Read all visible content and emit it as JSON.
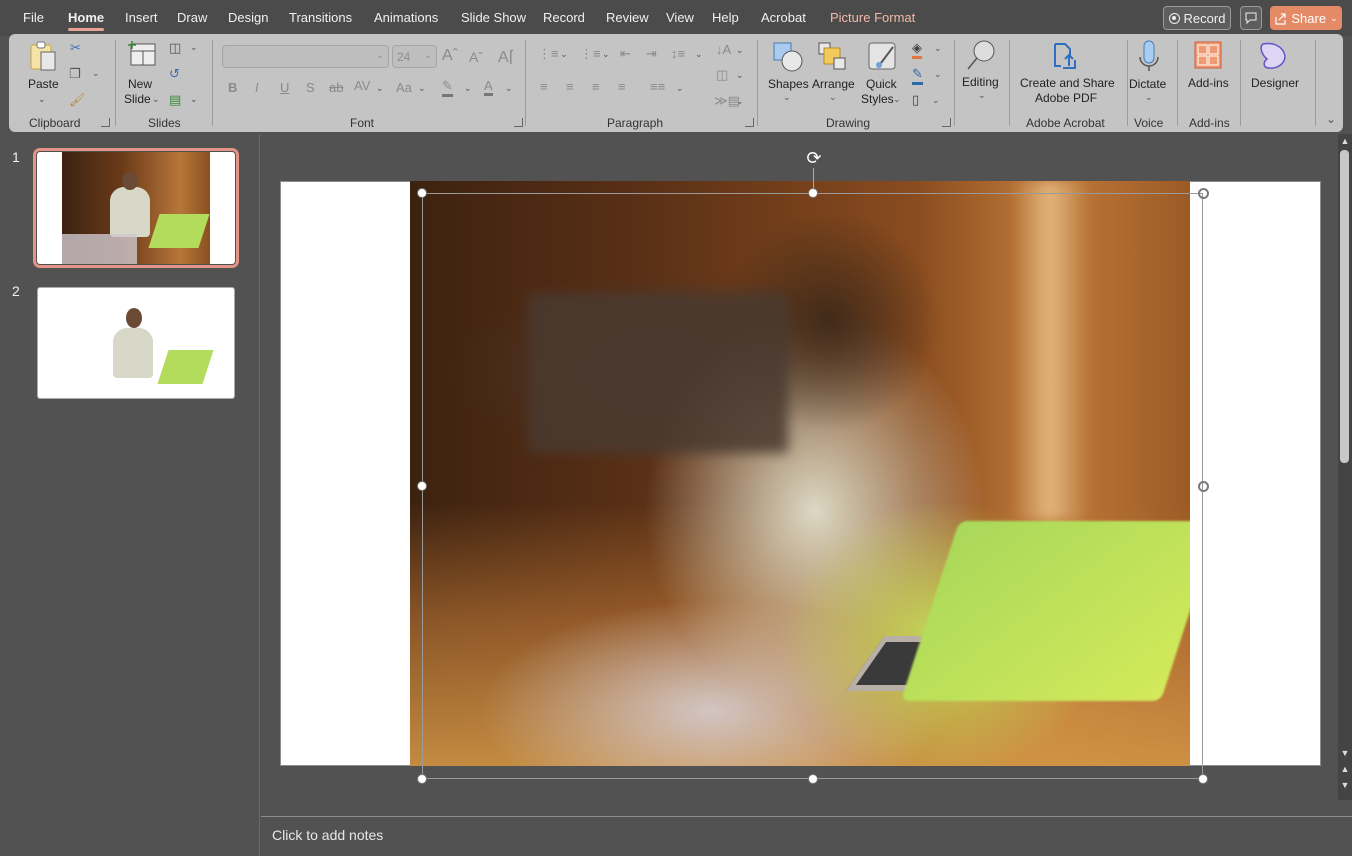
{
  "menubar": {
    "tabs": [
      {
        "label": "File"
      },
      {
        "label": "Home",
        "active": true
      },
      {
        "label": "Insert"
      },
      {
        "label": "Draw"
      },
      {
        "label": "Design"
      },
      {
        "label": "Transitions"
      },
      {
        "label": "Animations"
      },
      {
        "label": "Slide Show"
      },
      {
        "label": "Record"
      },
      {
        "label": "Review"
      },
      {
        "label": "View"
      },
      {
        "label": "Help"
      },
      {
        "label": "Acrobat"
      },
      {
        "label": "Picture Format",
        "contextual": true
      }
    ],
    "record_button": "Record",
    "comment_icon": "comment-icon",
    "share_button": "Share"
  },
  "ribbon": {
    "clipboard": {
      "paste": "Paste",
      "group": "Clipboard"
    },
    "slides": {
      "new_slide_line1": "New",
      "new_slide_line2": "Slide",
      "group": "Slides"
    },
    "font": {
      "font_name": "",
      "font_size": "24",
      "group": "Font",
      "buttons": [
        "B",
        "I",
        "U",
        "S",
        "ab",
        "AV",
        "Aa"
      ]
    },
    "paragraph": {
      "group": "Paragraph"
    },
    "drawing": {
      "shapes": "Shapes",
      "arrange": "Arrange",
      "quick_styles_line1": "Quick",
      "quick_styles_line2": "Styles",
      "group": "Drawing"
    },
    "editing": {
      "label": "Editing"
    },
    "acrobat": {
      "line1": "Create and Share",
      "line2": "Adobe PDF",
      "group": "Adobe Acrobat"
    },
    "voice": {
      "dictate": "Dictate",
      "group": "Voice"
    },
    "addins": {
      "label": "Add-ins",
      "group": "Add-ins"
    },
    "designer": {
      "label": "Designer"
    }
  },
  "slides_panel": {
    "slides": [
      {
        "number": "1",
        "selected": true,
        "description": "Man at laptop in office, full background photo"
      },
      {
        "number": "2",
        "selected": false,
        "description": "Man at laptop, background removed"
      }
    ]
  },
  "editor": {
    "selected_object": "picture",
    "notes_placeholder": "Click to add notes"
  },
  "colors": {
    "accent_tab_underline": "#e8a394",
    "share_button": "#e58a67",
    "contextual_tab": "#f2b9a8",
    "ribbon_bg": "#c4c4c4",
    "app_bg": "#525252"
  }
}
